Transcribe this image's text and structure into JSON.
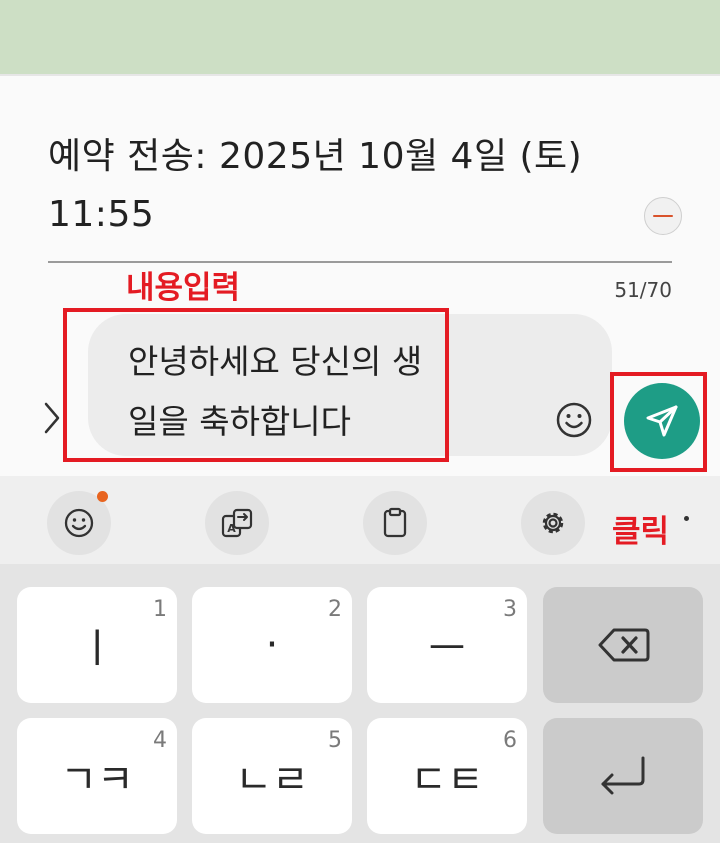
{
  "schedule": {
    "text": "예약 전송: 2025년 10월 4일 (토) 11:55",
    "char_count": "51/70"
  },
  "message": {
    "text": "안녕하세요 당신의 생일을 축하합니다"
  },
  "annotations": {
    "input_label": "내용입력",
    "click_label": "클릭"
  },
  "toolbar": {
    "items": [
      "emoji-icon",
      "translate-icon",
      "clipboard-icon",
      "settings-icon"
    ]
  },
  "keyboard": {
    "row1": [
      {
        "glyph": "ㅣ",
        "num": "1"
      },
      {
        "glyph": "·",
        "num": "2"
      },
      {
        "glyph": "ㅡ",
        "num": "3"
      }
    ],
    "row2": [
      {
        "glyph": "ㄱㅋ",
        "num": "4"
      },
      {
        "glyph": "ㄴㄹ",
        "num": "5"
      },
      {
        "glyph": "ㄷㅌ",
        "num": "6"
      }
    ],
    "backspace_icon": "backspace-icon",
    "enter_icon": "enter-icon"
  },
  "colors": {
    "send_button": "#1e9d86",
    "annotation": "#e41b23",
    "remove_minus": "#d9532c",
    "notification_dot": "#e8641f"
  }
}
